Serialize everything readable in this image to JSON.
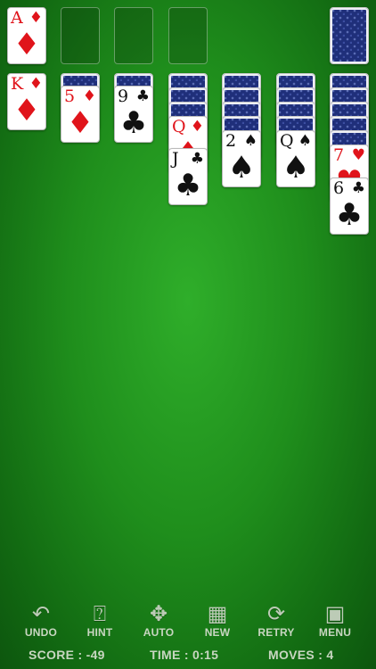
{
  "foundation": {
    "card": {
      "rank": "A",
      "suit": "♦",
      "color": "red"
    }
  },
  "tableau": [
    {
      "face_down": 0,
      "face_up": [
        {
          "rank": "K",
          "suit": "♦",
          "color": "red"
        }
      ]
    },
    {
      "face_down": 1,
      "face_up": [
        {
          "rank": "5",
          "suit": "♦",
          "color": "red"
        }
      ]
    },
    {
      "face_down": 1,
      "face_up": [
        {
          "rank": "9",
          "suit": "♣",
          "color": "black"
        }
      ]
    },
    {
      "face_down": 3,
      "face_up": [
        {
          "rank": "Q",
          "suit": "♦",
          "color": "red"
        },
        {
          "rank": "J",
          "suit": "♣",
          "color": "black"
        }
      ]
    },
    {
      "face_down": 4,
      "face_up": [
        {
          "rank": "2",
          "suit": "♠",
          "color": "black"
        }
      ]
    },
    {
      "face_down": 4,
      "face_up": [
        {
          "rank": "Q",
          "suit": "♠",
          "color": "black"
        }
      ]
    },
    {
      "face_down": 5,
      "face_up": [
        {
          "rank": "7",
          "suit": "♥",
          "color": "red"
        },
        {
          "rank": "6",
          "suit": "♣",
          "color": "black"
        }
      ]
    }
  ],
  "toolbar": {
    "undo": {
      "label": "UNDO",
      "icon": "undo-arrow-icon"
    },
    "hint": {
      "label": "HINT",
      "icon": "hint-question-icon"
    },
    "auto": {
      "label": "AUTO",
      "icon": "auto-arrows-icon"
    },
    "new": {
      "label": "NEW",
      "icon": "new-game-icon"
    },
    "retry": {
      "label": "RETRY",
      "icon": "retry-circle-icon"
    },
    "menu": {
      "label": "MENU",
      "icon": "menu-cards-icon"
    }
  },
  "status": {
    "score": "SCORE : -49",
    "time": "TIME : 0:15",
    "moves": "MOVES : 4"
  },
  "colors": {
    "felt": "#1f8e1c",
    "red_suit": "#e0141b",
    "card_back": "#1f2f7a"
  }
}
